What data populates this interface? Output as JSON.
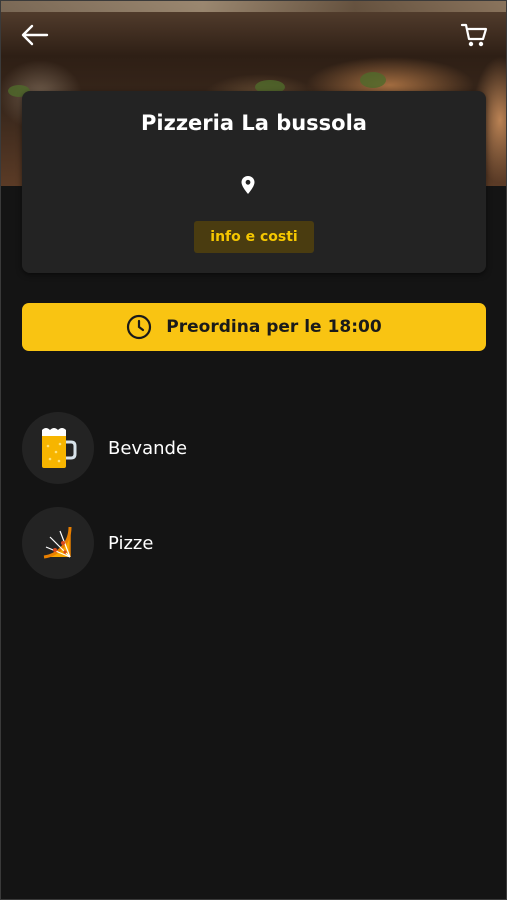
{
  "header": {
    "back_icon": "arrow-left-icon",
    "cart_icon": "shopping-cart-icon"
  },
  "restaurant": {
    "name": "Pizzeria La bussola",
    "location_icon": "map-pin-icon",
    "info_button_label": "info e costi"
  },
  "preorder": {
    "icon": "clock-icon",
    "label": "Preordina per le",
    "time": "18:00"
  },
  "categories": [
    {
      "label": "Bevande",
      "icon": "beer-mug-icon"
    },
    {
      "label": "Pizze",
      "icon": "pizza-slice-icon"
    }
  ],
  "colors": {
    "background": "#141414",
    "card": "#232323",
    "accent": "#f9c412",
    "info_button_bg": "#4a3c10",
    "info_button_text": "#f6c800",
    "text": "#ffffff"
  }
}
